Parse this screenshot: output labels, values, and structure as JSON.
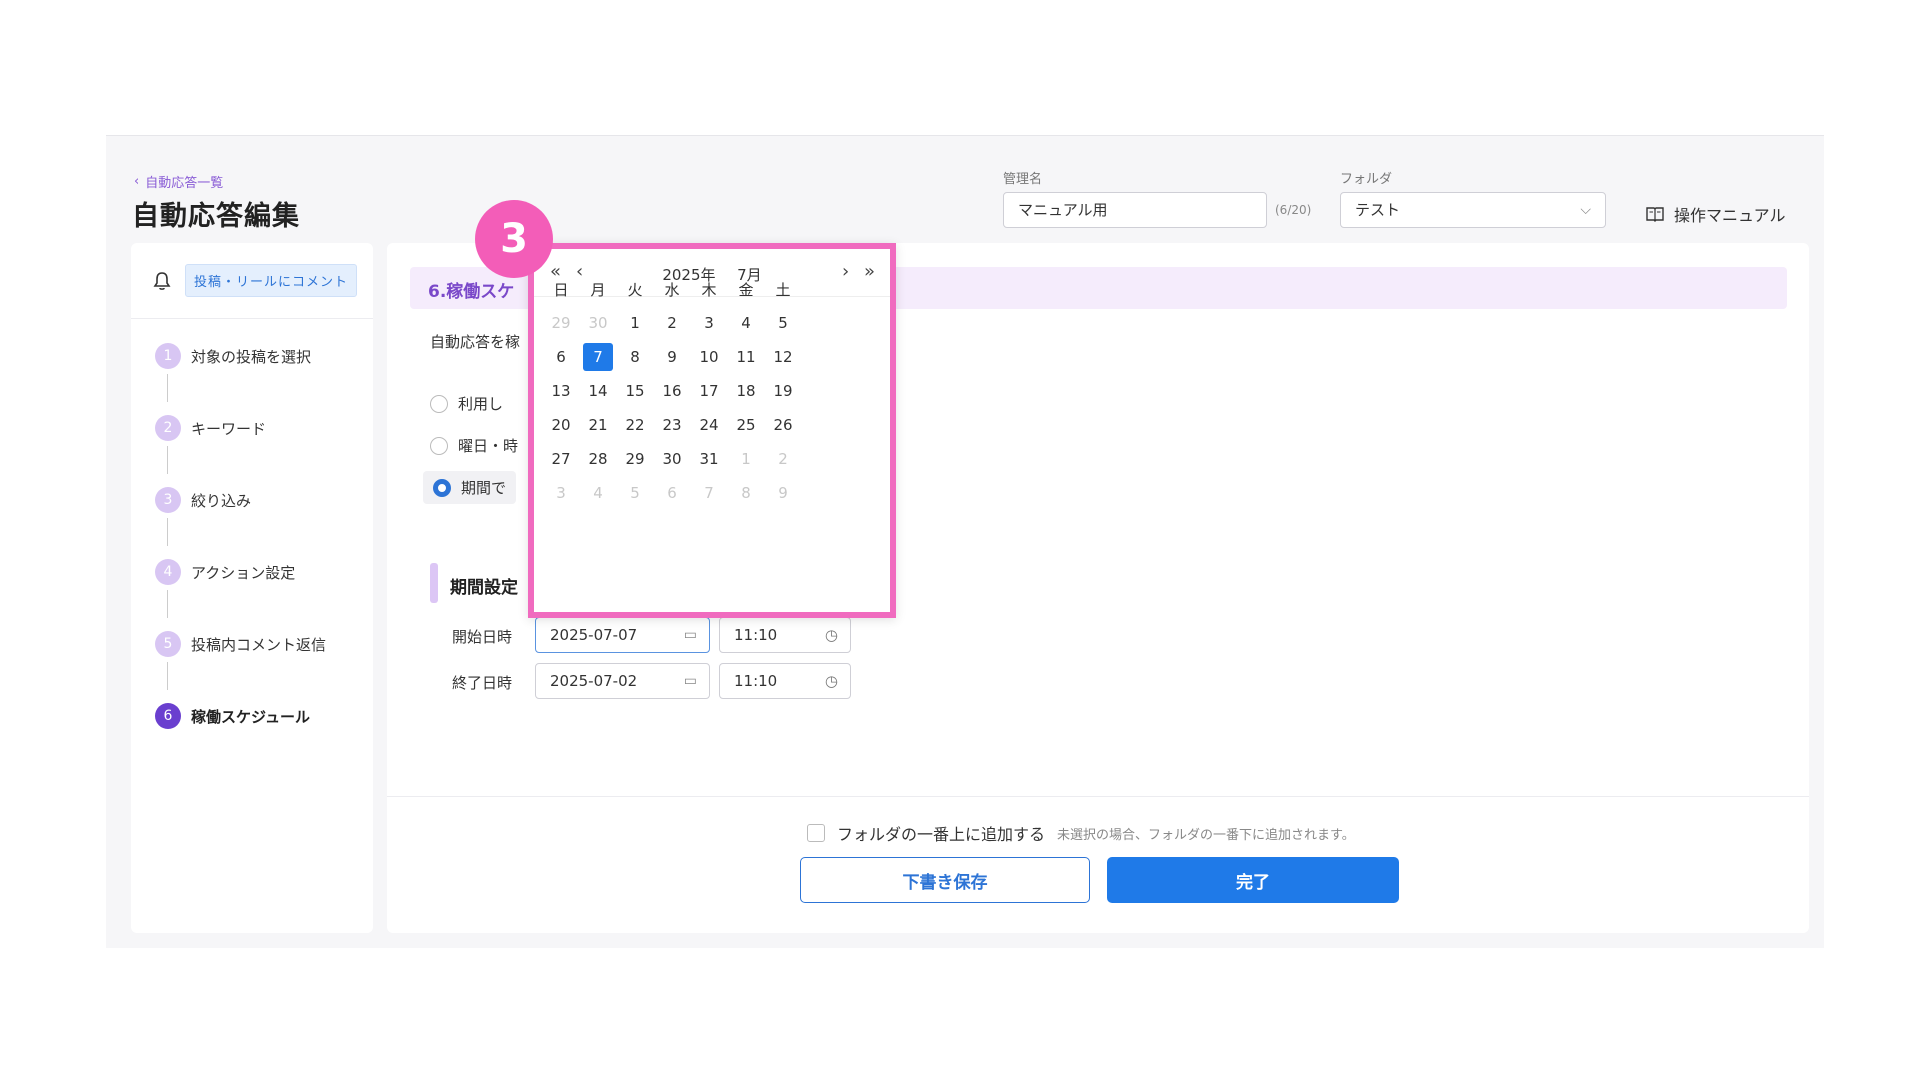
{
  "header": {
    "back_label": "自動応答一覧",
    "page_title": "自動応答編集",
    "name_label": "管理名",
    "name_value": "マニュアル用",
    "name_counter": "(6/20)",
    "folder_label": "フォルダ",
    "folder_value": "テスト",
    "manual_label": "操作マニュアル"
  },
  "sidebar": {
    "type_badge": "投稿・リールにコメント",
    "steps": [
      {
        "num": "1",
        "label": "対象の投稿を選択"
      },
      {
        "num": "2",
        "label": "キーワード"
      },
      {
        "num": "3",
        "label": "絞り込み"
      },
      {
        "num": "4",
        "label": "アクション設定"
      },
      {
        "num": "5",
        "label": "投稿内コメント返信"
      },
      {
        "num": "6",
        "label": "稼働スケジュール"
      }
    ]
  },
  "main": {
    "section_title": "6.稼働スケ",
    "operate_label": "自動応答を稼",
    "radio_options": [
      "利用し",
      "曜日・時",
      "期間で"
    ],
    "period_title": "期間設定",
    "start_label": "開始日時",
    "start_date": "2025-07-07",
    "start_time": "11:10",
    "end_label": "終了日時",
    "end_date": "2025-07-02",
    "end_time": "11:10"
  },
  "footer": {
    "top_check_label": "フォルダの一番上に追加する",
    "top_check_note": "未選択の場合、フォルダの一番下に追加されます。",
    "draft_button": "下書き保存",
    "done_button": "完了"
  },
  "calendar": {
    "year_label": "2025年",
    "month_label": "7月",
    "weekdays": [
      "日",
      "月",
      "火",
      "水",
      "木",
      "金",
      "土"
    ],
    "days": [
      [
        "29",
        "30",
        "1",
        "2",
        "3",
        "4",
        "5"
      ],
      [
        "6",
        "7",
        "8",
        "9",
        "10",
        "11",
        "12"
      ],
      [
        "13",
        "14",
        "15",
        "16",
        "17",
        "18",
        "19"
      ],
      [
        "20",
        "21",
        "22",
        "23",
        "24",
        "25",
        "26"
      ],
      [
        "27",
        "28",
        "29",
        "30",
        "31",
        "1",
        "2"
      ],
      [
        "3",
        "4",
        "5",
        "6",
        "7",
        "8",
        "9"
      ]
    ],
    "selected_day": "7"
  },
  "annotation": {
    "step_number": "3",
    "highlight_color": "#f06bbf"
  },
  "icons": {
    "back": "chevron-left-icon",
    "manual": "book-icon",
    "type": "bell-icon",
    "date": "calendar-icon",
    "time": "clock-icon"
  }
}
